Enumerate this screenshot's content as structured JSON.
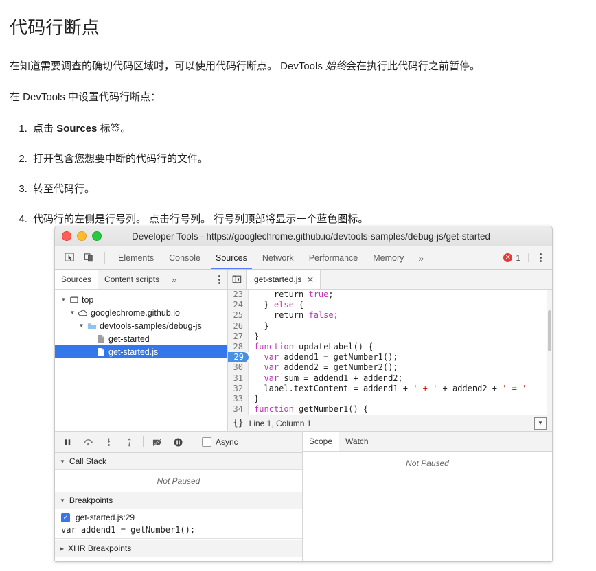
{
  "article": {
    "title": "代码行断点",
    "intro_before_em": "在知道需要调查的确切代码区域时，可以使用代码行断点。 DevTools ",
    "intro_em": "始终",
    "intro_after_em": "会在执行此代码行之前暂停。",
    "lead": "在 DevTools 中设置代码行断点：",
    "steps": [
      {
        "before": "点击 ",
        "bold": "Sources",
        "after": " 标签。"
      },
      {
        "before": "打开包含您想要中断的代码行的文件。",
        "bold": "",
        "after": ""
      },
      {
        "before": "转至代码行。",
        "bold": "",
        "after": ""
      },
      {
        "before": "代码行的左侧是行号列。 点击行号列。 行号列顶部将显示一个蓝色图标。",
        "bold": "",
        "after": ""
      }
    ]
  },
  "devtools": {
    "window_title": "Developer Tools - https://googlechrome.github.io/devtools-samples/debug-js/get-started",
    "traffic_lights": [
      "close-red",
      "minimize-yellow",
      "maximize-green"
    ],
    "toolbar_icons": [
      "inspect-element-icon",
      "device-toolbar-icon"
    ],
    "tabs": [
      {
        "label": "Elements",
        "active": false
      },
      {
        "label": "Console",
        "active": false
      },
      {
        "label": "Sources",
        "active": true
      },
      {
        "label": "Network",
        "active": false
      },
      {
        "label": "Performance",
        "active": false
      },
      {
        "label": "Memory",
        "active": false
      }
    ],
    "tabs_overflow": "»",
    "error_badge": {
      "icon": "error-icon",
      "count": "1"
    },
    "main_menu_icon": "kebab-menu-icon",
    "accent_color": "#5b7cfa",
    "selection_color": "#3477eb",
    "sources": {
      "sub_tabs": [
        {
          "label": "Sources",
          "active": true
        },
        {
          "label": "Content scripts",
          "active": false
        }
      ],
      "sub_tabs_overflow": "»",
      "sub_menu_icon": "kebab-menu-icon",
      "collapse_icon": "collapse-navigator-icon",
      "open_file_tab": {
        "label": "get-started.js",
        "close": "✕"
      },
      "tree": [
        {
          "indent": 0,
          "twisty": "▼",
          "icon": "frame-icon",
          "label": "top",
          "selected": false
        },
        {
          "indent": 1,
          "twisty": "▼",
          "icon": "cloud-icon",
          "label": "googlechrome.github.io",
          "selected": false
        },
        {
          "indent": 2,
          "twisty": "▼",
          "icon": "folder-icon",
          "label": "devtools-samples/debug-js",
          "selected": false
        },
        {
          "indent": 3,
          "twisty": "",
          "icon": "document-icon",
          "label": "get-started",
          "selected": false
        },
        {
          "indent": 3,
          "twisty": "",
          "icon": "script-icon",
          "label": "get-started.js",
          "selected": true
        }
      ],
      "code": [
        {
          "num": "23",
          "bp": false,
          "tokens": [
            {
              "t": "    return ",
              "c": ""
            },
            {
              "t": "true",
              "c": "k"
            },
            {
              "t": ";",
              "c": ""
            }
          ]
        },
        {
          "num": "24",
          "bp": false,
          "tokens": [
            {
              "t": "  } ",
              "c": ""
            },
            {
              "t": "else",
              "c": "k"
            },
            {
              "t": " {",
              "c": ""
            }
          ]
        },
        {
          "num": "25",
          "bp": false,
          "tokens": [
            {
              "t": "    return ",
              "c": ""
            },
            {
              "t": "false",
              "c": "k"
            },
            {
              "t": ";",
              "c": ""
            }
          ]
        },
        {
          "num": "26",
          "bp": false,
          "tokens": [
            {
              "t": "  }",
              "c": ""
            }
          ]
        },
        {
          "num": "27",
          "bp": false,
          "tokens": [
            {
              "t": "}",
              "c": ""
            }
          ]
        },
        {
          "num": "28",
          "bp": false,
          "tokens": [
            {
              "t": "function",
              "c": "k"
            },
            {
              "t": " updateLabel() {",
              "c": ""
            }
          ]
        },
        {
          "num": "29",
          "bp": true,
          "tokens": [
            {
              "t": "  ",
              "c": ""
            },
            {
              "t": "var",
              "c": "k"
            },
            {
              "t": " addend1 = getNumber1();",
              "c": ""
            }
          ]
        },
        {
          "num": "30",
          "bp": false,
          "tokens": [
            {
              "t": "  ",
              "c": ""
            },
            {
              "t": "var",
              "c": "k"
            },
            {
              "t": " addend2 = getNumber2();",
              "c": ""
            }
          ]
        },
        {
          "num": "31",
          "bp": false,
          "tokens": [
            {
              "t": "  ",
              "c": ""
            },
            {
              "t": "var",
              "c": "k"
            },
            {
              "t": " sum = addend1 + addend2;",
              "c": ""
            }
          ]
        },
        {
          "num": "32",
          "bp": false,
          "tokens": [
            {
              "t": "  label.textContent = addend1 + ",
              "c": ""
            },
            {
              "t": "' + '",
              "c": "str"
            },
            {
              "t": " + addend2 + ",
              "c": ""
            },
            {
              "t": "' = '",
              "c": "str"
            }
          ]
        },
        {
          "num": "33",
          "bp": false,
          "tokens": [
            {
              "t": "}",
              "c": ""
            }
          ]
        },
        {
          "num": "34",
          "bp": false,
          "tokens": [
            {
              "t": "function",
              "c": "k"
            },
            {
              "t": " getNumber1() {",
              "c": ""
            }
          ]
        }
      ],
      "status_bar": {
        "format_icon": "{}",
        "position": "Line 1, Column 1",
        "right_icon": "jump-to-icon"
      }
    },
    "debugger": {
      "toolbar": [
        {
          "icon": "pause-resume-icon"
        },
        {
          "icon": "step-over-icon"
        },
        {
          "icon": "step-into-icon"
        },
        {
          "icon": "step-out-icon"
        },
        {
          "icon": "deactivate-breakpoints-icon"
        },
        {
          "icon": "pause-on-exceptions-icon"
        }
      ],
      "async_label": "Async",
      "async_checked": false,
      "call_stack": {
        "title": "Call Stack",
        "twisty": "▼",
        "empty": "Not Paused"
      },
      "breakpoints": {
        "title": "Breakpoints",
        "twisty": "▼",
        "items": [
          {
            "checked": true,
            "check_glyph": "✓",
            "label": "get-started.js:29",
            "code": "var addend1 = getNumber1();"
          }
        ]
      },
      "xhr_breakpoints": {
        "title": "XHR Breakpoints",
        "twisty": "▶"
      },
      "side_tabs": [
        {
          "label": "Scope",
          "active": true
        },
        {
          "label": "Watch",
          "active": false
        }
      ],
      "scope_empty": "Not Paused"
    }
  }
}
